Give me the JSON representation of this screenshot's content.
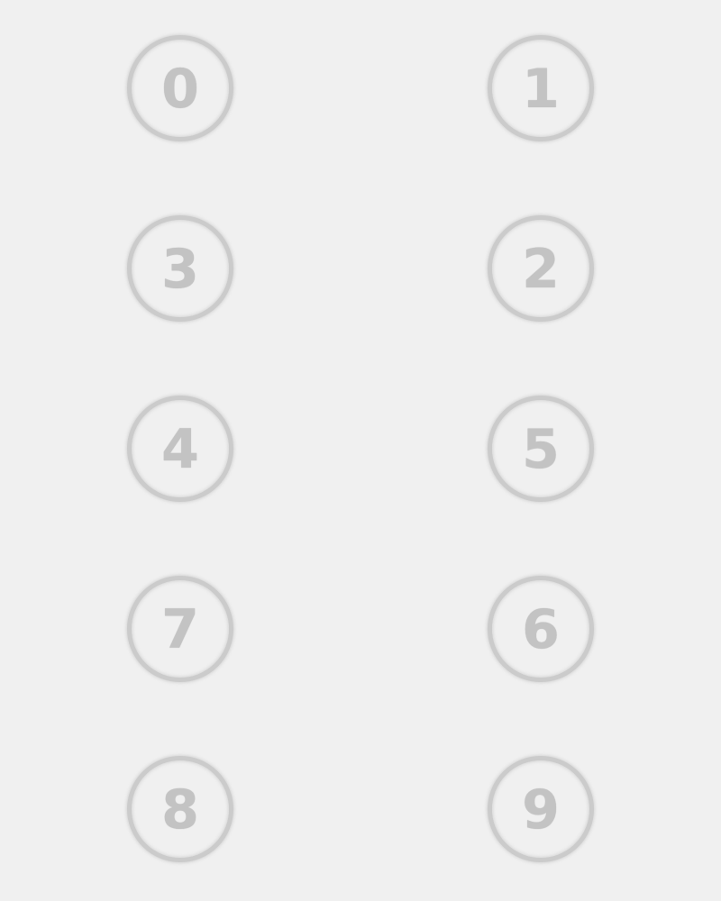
{
  "buttons": [
    {
      "label": "0"
    },
    {
      "label": "1"
    },
    {
      "label": "3"
    },
    {
      "label": "2"
    },
    {
      "label": "4"
    },
    {
      "label": "5"
    },
    {
      "label": "7"
    },
    {
      "label": "6"
    },
    {
      "label": "8"
    },
    {
      "label": "9"
    }
  ],
  "colors": {
    "background": "#f0f0f0",
    "ring": "#cbcbcb",
    "digit": "#c3c3c3"
  }
}
